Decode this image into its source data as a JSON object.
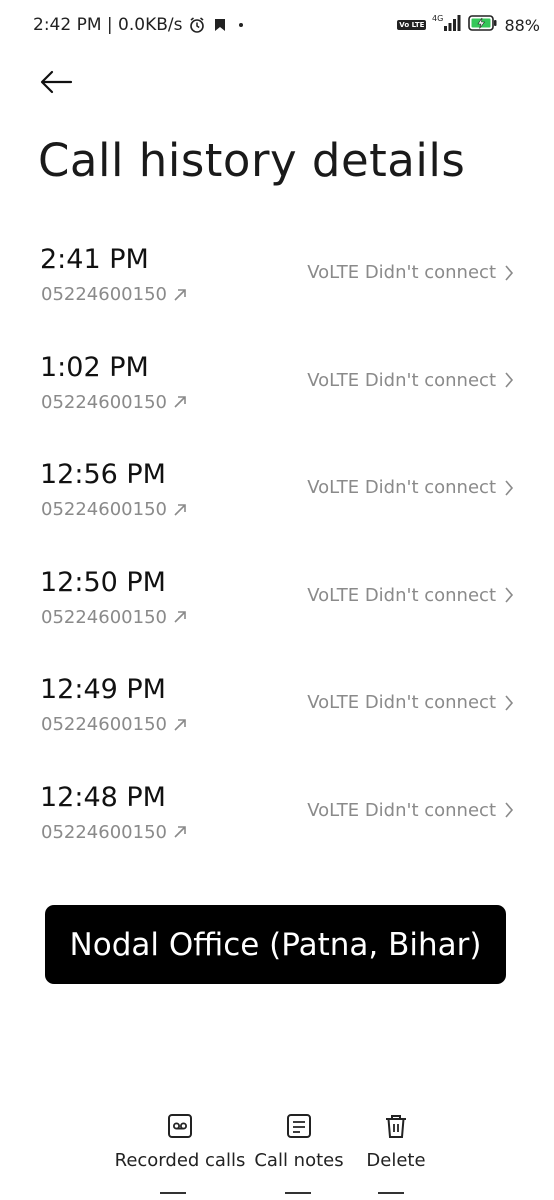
{
  "status_bar": {
    "time_speed": "2:42 PM | 0.0KB/s",
    "volte_badge": "Vo LTE",
    "network": "4G",
    "battery_percent": "88%",
    "icons": [
      "alarm-icon",
      "notification-icon",
      "dot-icon",
      "volte-icon",
      "signal-icon",
      "battery-charging-icon"
    ]
  },
  "header": {
    "back_icon": "back-arrow-icon",
    "title": "Call history details"
  },
  "calls": [
    {
      "time": "2:41 PM",
      "number": "05224600150",
      "status": "VoLTE Didn't connect"
    },
    {
      "time": "1:02 PM",
      "number": "05224600150",
      "status": "VoLTE Didn't connect"
    },
    {
      "time": "12:56 PM",
      "number": "05224600150",
      "status": "VoLTE Didn't connect"
    },
    {
      "time": "12:50 PM",
      "number": "05224600150",
      "status": "VoLTE Didn't connect"
    },
    {
      "time": "12:49 PM",
      "number": "05224600150",
      "status": "VoLTE Didn't connect"
    },
    {
      "time": "12:48 PM",
      "number": "05224600150",
      "status": "VoLTE Didn't connect"
    }
  ],
  "banner": {
    "text": "Nodal Office (Patna, Bihar)"
  },
  "toolbar": {
    "recorded_calls": "Recorded calls",
    "call_notes": "Call notes",
    "delete": "Delete"
  },
  "colors": {
    "secondary_text": "#8a8a8a",
    "banner_bg": "#000000",
    "battery_accent": "#35c759"
  }
}
